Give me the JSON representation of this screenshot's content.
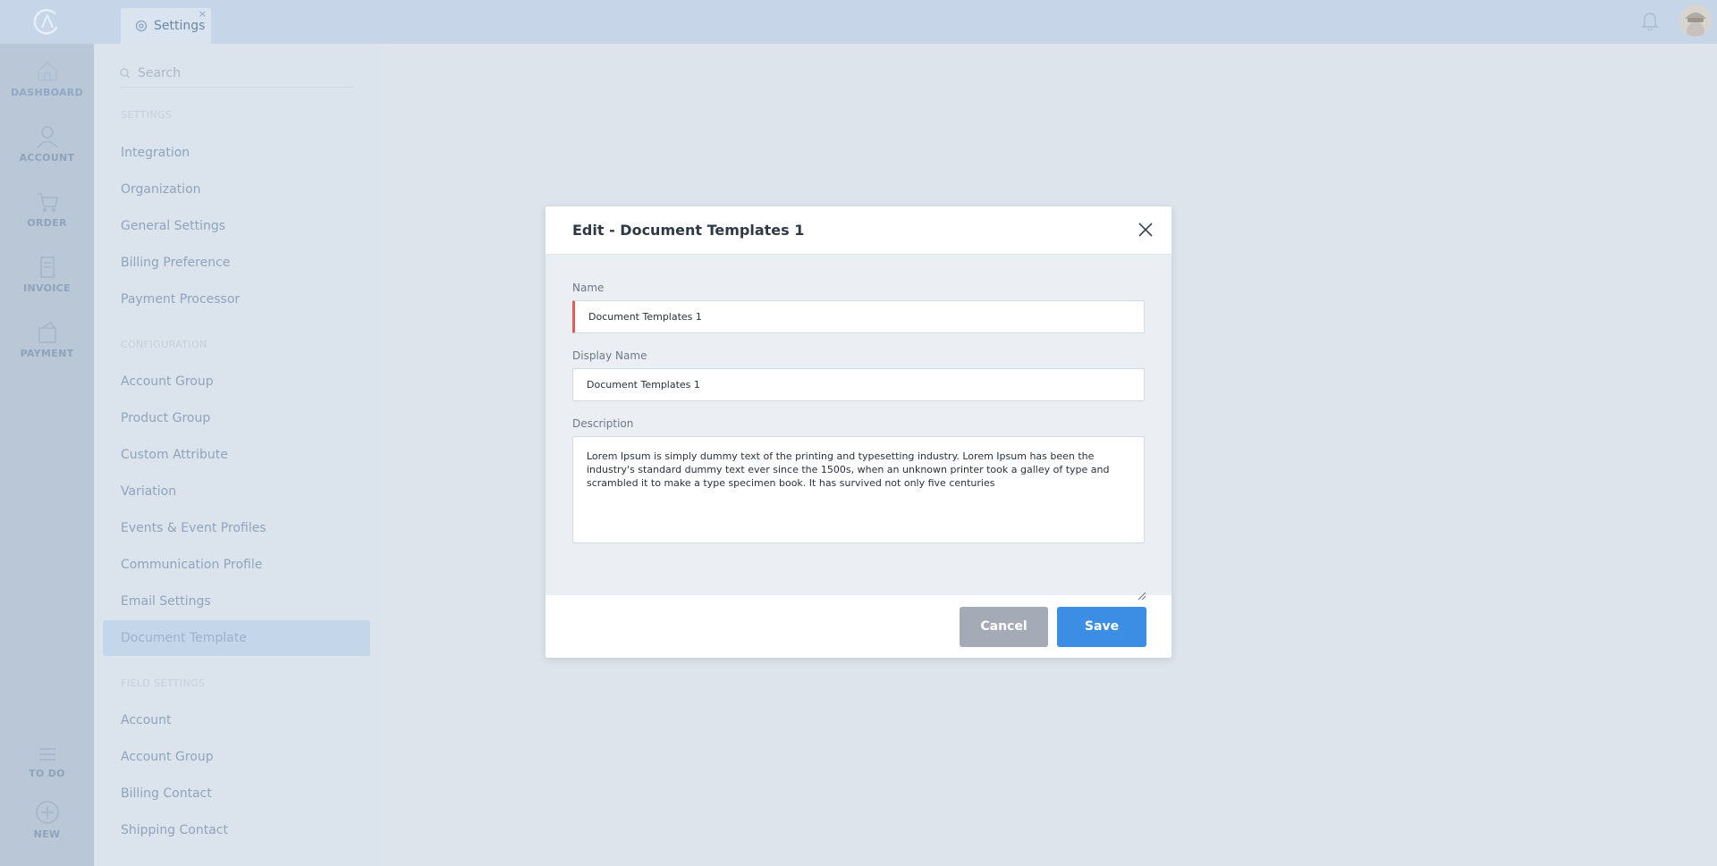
{
  "tab": {
    "label": "Settings",
    "close": "×"
  },
  "rail": {
    "items": [
      {
        "label": "DASHBOARD",
        "icon": "home-icon"
      },
      {
        "label": "ACCOUNT",
        "icon": "user-icon"
      },
      {
        "label": "ORDER",
        "icon": "cart-icon"
      },
      {
        "label": "INVOICE",
        "icon": "invoice-icon"
      },
      {
        "label": "PAYMENT",
        "icon": "payment-icon"
      },
      {
        "label": "TO DO",
        "icon": "list-icon"
      },
      {
        "label": "NEW",
        "icon": "plus-circle-icon"
      }
    ]
  },
  "settings_panel": {
    "search_placeholder": "Search",
    "sections": {
      "settings": "SETTINGS",
      "configuration": "CONFIGURATION",
      "field_settings": "FIELD SETTINGS"
    },
    "settings_items": [
      "Integration",
      "Organization",
      "General Settings",
      "Billing Preference",
      "Payment Processor"
    ],
    "configuration_items": [
      "Account Group",
      "Product Group",
      "Custom Attribute",
      "Variation",
      "Events & Event Profiles",
      "Communication Profile",
      "Email Settings",
      "Document Template"
    ],
    "field_items": [
      "Account",
      "Account Group",
      "Billing Contact",
      "Shipping Contact"
    ]
  },
  "modal": {
    "title": "Edit - Document Templates 1",
    "name_label": "Name",
    "name_value": "Document Templates 1",
    "display_name_label": "Display Name",
    "display_name_value": "Document Templates 1",
    "description_label": "Description",
    "description_value": "Lorem Ipsum is simply dummy text of the printing and typesetting industry. Lorem Ipsum has been the industry's standard dummy text ever since the 1500s, when an unknown printer took a galley of type and scrambled it to make a type specimen book. It has survived not only five centuries",
    "cancel_label": "Cancel",
    "save_label": "Save"
  },
  "colors": {
    "primary": "#3c8ee4",
    "cancel": "#a4abb6",
    "error": "#e25d55",
    "topbar": "#c6d6e8"
  }
}
